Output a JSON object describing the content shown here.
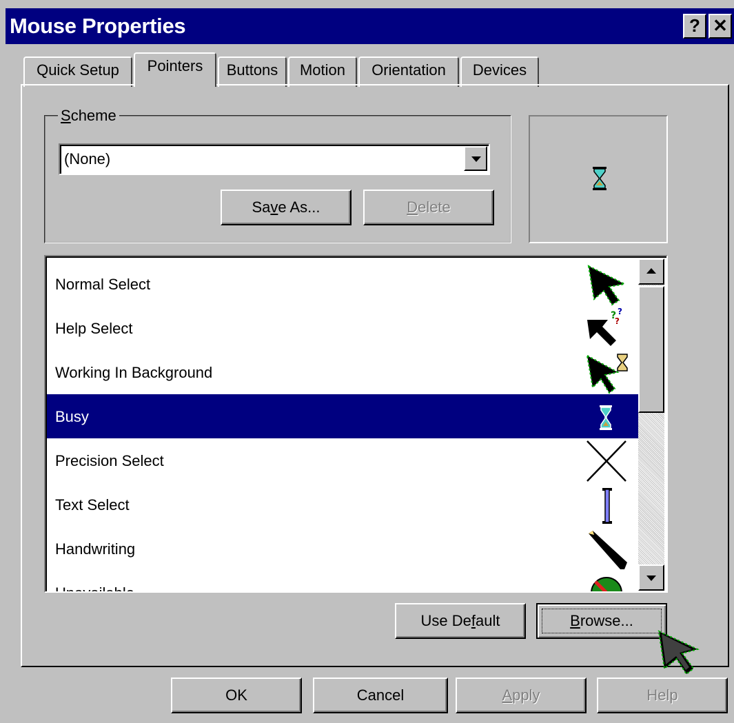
{
  "window": {
    "title": "Mouse Properties",
    "help_button": "?",
    "close_button": "✕"
  },
  "tabs": [
    {
      "label": "Quick Setup",
      "active": false
    },
    {
      "label": "Pointers",
      "active": true
    },
    {
      "label": "Buttons",
      "active": false
    },
    {
      "label": "Motion",
      "active": false
    },
    {
      "label": "Orientation",
      "active": false
    },
    {
      "label": "Devices",
      "active": false
    }
  ],
  "scheme": {
    "label_u": "S",
    "label_rest": "cheme",
    "value": "(None)",
    "save_as_pre": "Sa",
    "save_as_u": "v",
    "save_as_post": "e As...",
    "delete_u": "D",
    "delete_rest": "elete"
  },
  "preview_icon": "hourglass-icon",
  "pointers": [
    {
      "label": "Normal Select",
      "icon": "arrow-pointer-icon"
    },
    {
      "label": "Help Select",
      "icon": "help-pointer-icon"
    },
    {
      "label": "Working In Background",
      "icon": "working-pointer-icon"
    },
    {
      "label": "Busy",
      "icon": "hourglass-icon",
      "selected": true
    },
    {
      "label": "Precision Select",
      "icon": "crosshair-icon"
    },
    {
      "label": "Text Select",
      "icon": "ibeam-icon"
    },
    {
      "label": "Handwriting",
      "icon": "pen-icon"
    },
    {
      "label": "Unavailable",
      "icon": "unavailable-icon"
    }
  ],
  "list_buttons": {
    "use_default_pre": "Use De",
    "use_default_u": "f",
    "use_default_post": "ault",
    "browse_u": "B",
    "browse_rest": "rowse..."
  },
  "dialog_buttons": {
    "ok": "OK",
    "cancel": "Cancel",
    "apply_u": "A",
    "apply_rest": "pply",
    "help": "Help"
  },
  "colors": {
    "titlebar": "#000080",
    "selection": "#000080",
    "face": "#c0c0c0"
  }
}
